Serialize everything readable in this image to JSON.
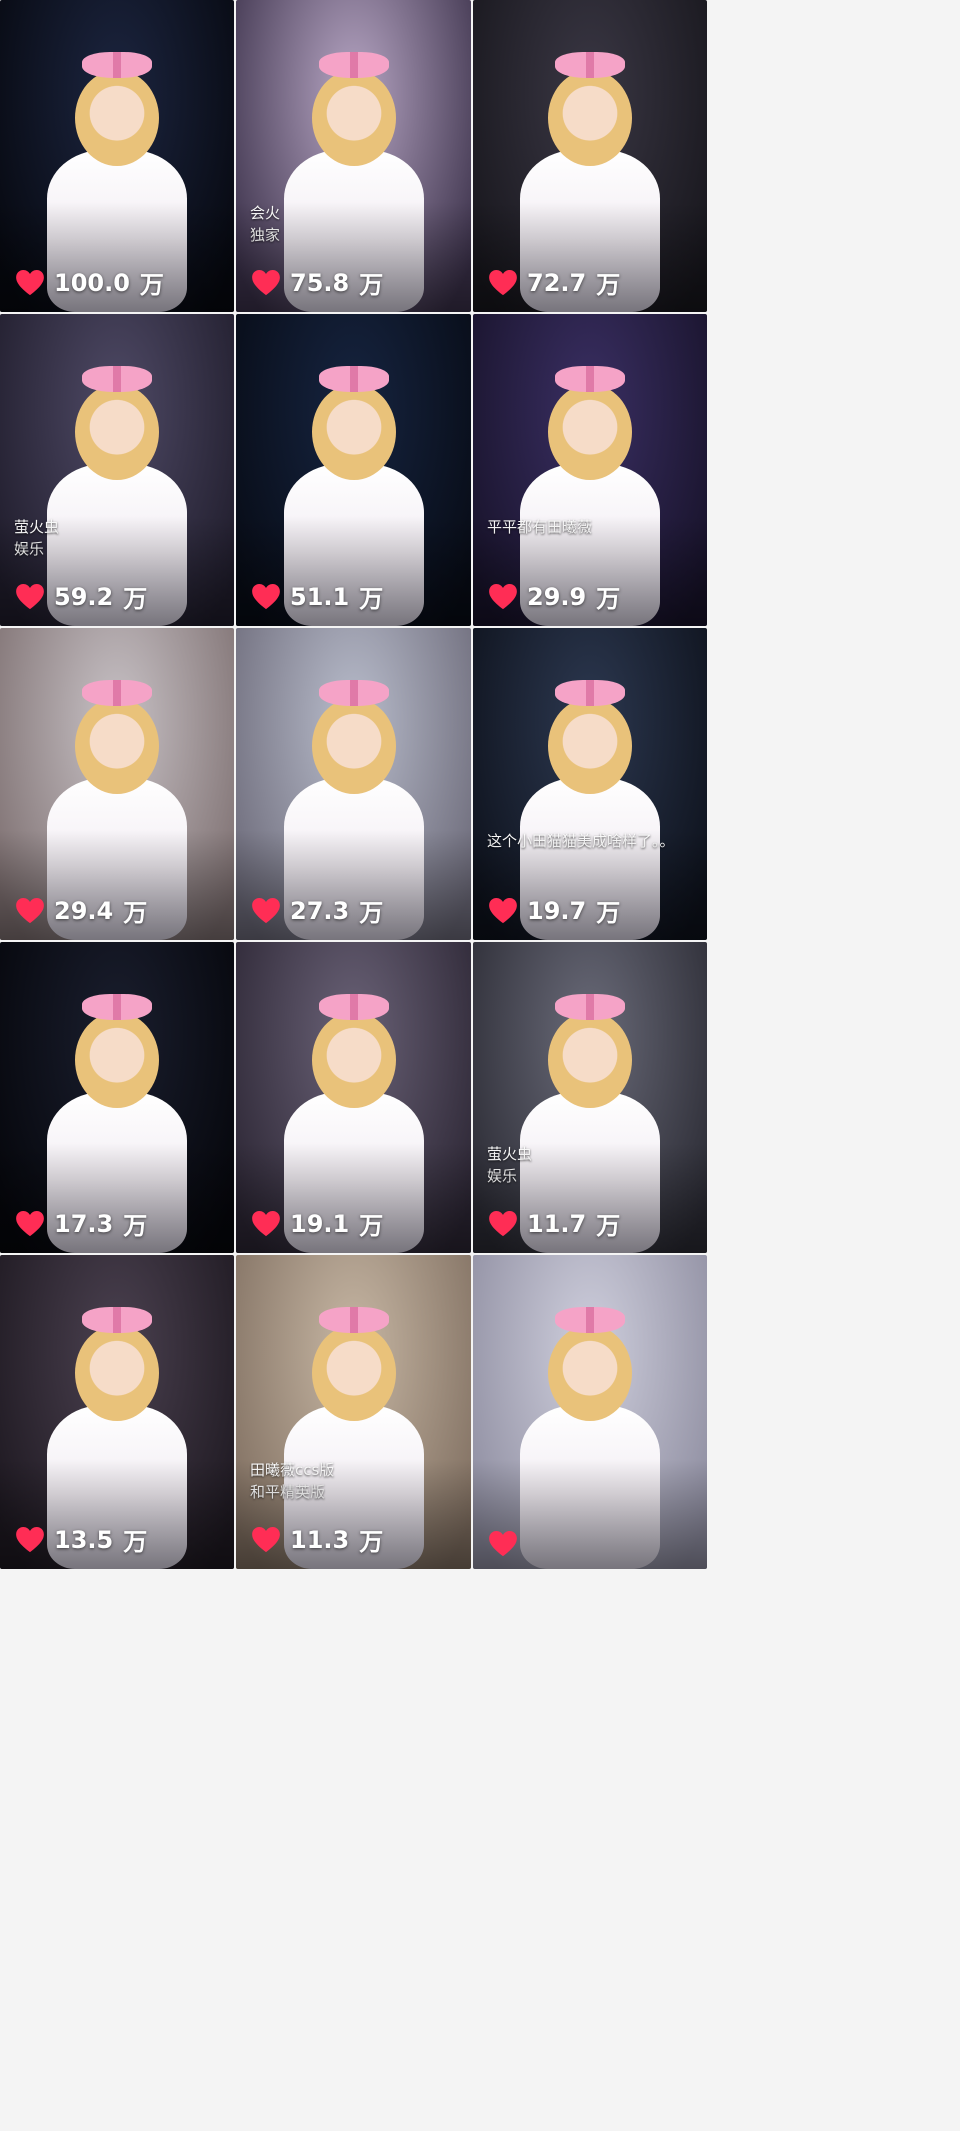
{
  "feed": {
    "tiles": [
      {
        "likes_value": "100.0",
        "likes_unit": "万",
        "bg": "#1c2540",
        "bg2": "#06080f",
        "overlay": "",
        "overlay2": ""
      },
      {
        "likes_value": "75.8",
        "likes_unit": "万",
        "bg": "#b7a6c4",
        "bg2": "#3a3049",
        "overlay": "会火",
        "overlay2": "独家"
      },
      {
        "likes_value": "72.7",
        "likes_unit": "万",
        "bg": "#3a3744",
        "bg2": "#17161c",
        "overlay": "",
        "overlay2": ""
      },
      {
        "likes_value": "59.2",
        "likes_unit": "万",
        "bg": "#4f4a66",
        "bg2": "#1f1c2b",
        "overlay": "萤火虫",
        "overlay2": "娱乐"
      },
      {
        "likes_value": "51.1",
        "likes_unit": "万",
        "bg": "#162440",
        "bg2": "#070b15",
        "overlay": "",
        "overlay2": ""
      },
      {
        "likes_value": "29.9",
        "likes_unit": "万",
        "bg": "#3a2f63",
        "bg2": "#171229",
        "overlay": "平平都有田曦薇",
        "overlay2": ""
      },
      {
        "likes_value": "29.4",
        "likes_unit": "万",
        "bg": "#c8c2c6",
        "bg2": "#7d6f70",
        "overlay": "",
        "overlay2": ""
      },
      {
        "likes_value": "27.3",
        "likes_unit": "万",
        "bg": "#b9bdcc",
        "bg2": "#6b6978",
        "overlay": "",
        "overlay2": ""
      },
      {
        "likes_value": "19.7",
        "likes_unit": "万",
        "bg": "#2c3850",
        "bg2": "#0d111b",
        "overlay": "这个小田猫猫美成啥样了。。",
        "overlay2": ""
      },
      {
        "likes_value": "17.3",
        "likes_unit": "万",
        "bg": "#1a1e2e",
        "bg2": "#05060b",
        "overlay": "",
        "overlay2": ""
      },
      {
        "likes_value": "19.1",
        "likes_unit": "万",
        "bg": "#6a6277",
        "bg2": "#2b2533",
        "overlay": "",
        "overlay2": ""
      },
      {
        "likes_value": "11.7",
        "likes_unit": "万",
        "bg": "#6a6b79",
        "bg2": "#2a2a33",
        "overlay": "萤火虫",
        "overlay2": "娱乐"
      },
      {
        "likes_value": "13.5",
        "likes_unit": "万",
        "bg": "#4b4150",
        "bg2": "#1d1820",
        "overlay": "",
        "overlay2": ""
      },
      {
        "likes_value": "11.3",
        "likes_unit": "万",
        "bg": "#c7b7a4",
        "bg2": "#7f6e60",
        "overlay": "田曦薇ccs版",
        "overlay2": "和平精英版"
      },
      {
        "likes_value": "",
        "likes_unit": "",
        "bg": "#cfcfdd",
        "bg2": "#8d8c9f",
        "overlay": "",
        "overlay2": ""
      }
    ],
    "heart_color": "#ff2d55",
    "heart_icon": "heart-icon"
  }
}
